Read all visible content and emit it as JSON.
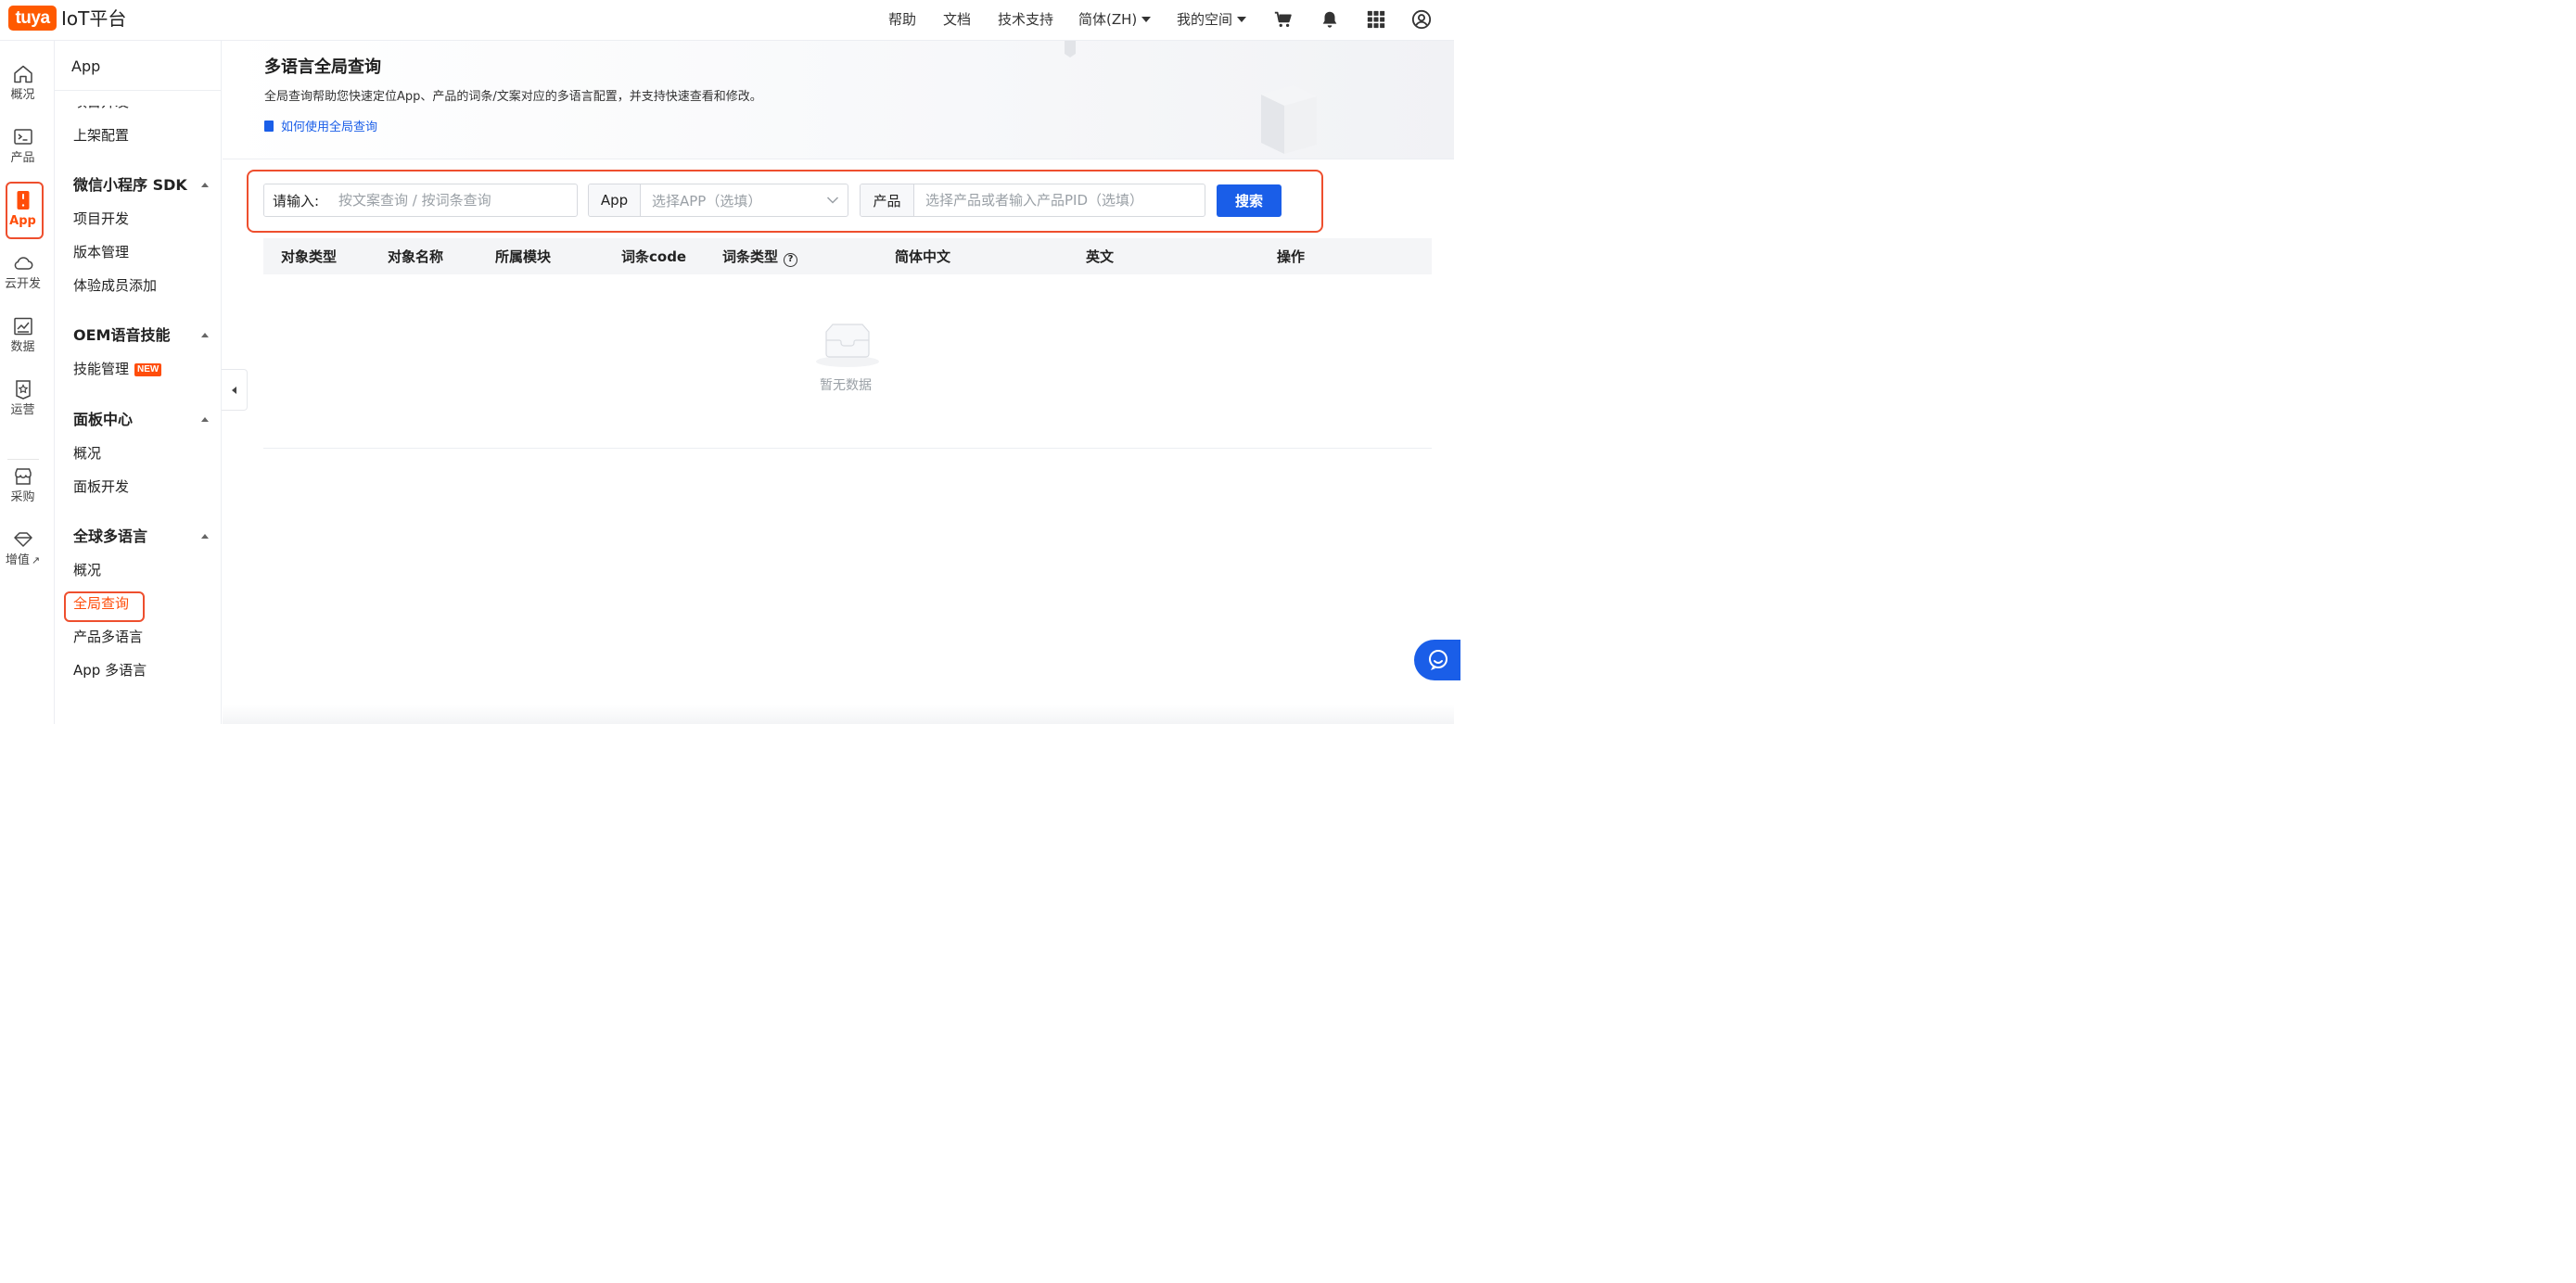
{
  "brand": {
    "logo_text": "tuya",
    "title": "IoT平台",
    "accent": "#ff4d0a",
    "primary": "#1a5ee8"
  },
  "topnav": {
    "help": "帮助",
    "docs": "文档",
    "support": "技术支持",
    "language": "简体(ZH)",
    "workspace": "我的空间"
  },
  "rail": {
    "items": [
      {
        "label": "概况",
        "icon": "home-icon"
      },
      {
        "label": "产品",
        "icon": "terminal-icon"
      },
      {
        "label": "App",
        "icon": "phone-icon",
        "active": true
      },
      {
        "label": "云开发",
        "icon": "cloud-icon"
      },
      {
        "label": "数据",
        "icon": "chart-icon"
      },
      {
        "label": "运营",
        "icon": "star-badge-icon"
      },
      {
        "label": "采购",
        "icon": "store-icon"
      },
      {
        "label": "增值",
        "icon": "diamond-icon"
      }
    ]
  },
  "subnav": {
    "title": "App",
    "partial_item": "项目开发",
    "listing": "上架配置",
    "groups": [
      {
        "title": "微信小程序 SDK",
        "items": [
          "项目开发",
          "版本管理",
          "体验成员添加"
        ]
      },
      {
        "title": "OEM语音技能",
        "items": [
          "技能管理"
        ],
        "badge": "NEW"
      },
      {
        "title": "面板中心",
        "items": [
          "概况",
          "面板开发"
        ]
      },
      {
        "title": "全球多语言",
        "items": [
          "概况",
          "全局查询",
          "产品多语言",
          "App 多语言"
        ]
      }
    ]
  },
  "banner": {
    "title": "多语言全局查询",
    "description": "全局查询帮助您快速定位App、产品的词条/文案对应的多语言配置，并支持快速查看和修改。",
    "link": "如何使用全局查询"
  },
  "search": {
    "keyword_label": "请输入:",
    "keyword_placeholder": "按文案查询 / 按词条查询",
    "app_label": "App",
    "app_placeholder": "选择APP（选填）",
    "product_label": "产品",
    "product_placeholder": "选择产品或者输入产品PID（选填）",
    "button": "搜索"
  },
  "table": {
    "columns": [
      "对象类型",
      "对象名称",
      "所属模块",
      "词条code",
      "词条类型",
      "简体中文",
      "英文",
      "操作"
    ],
    "empty_text": "暂无数据"
  }
}
